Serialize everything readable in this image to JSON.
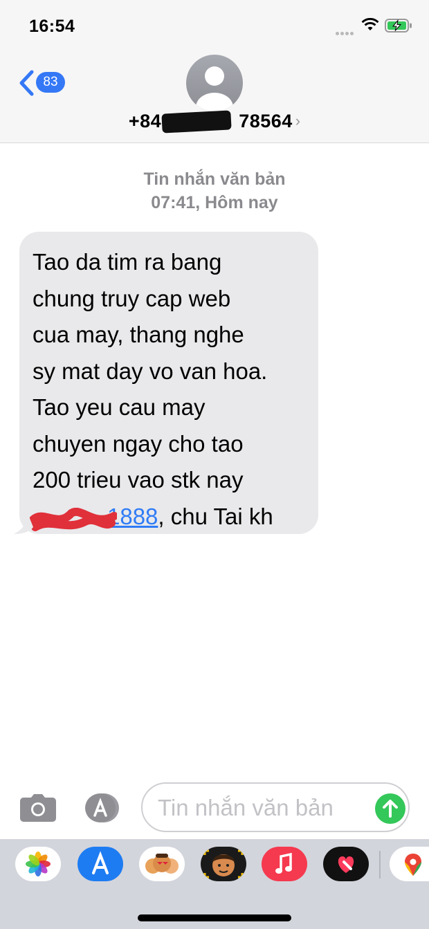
{
  "status_bar": {
    "time": "16:54"
  },
  "nav": {
    "unread_count": "83"
  },
  "contact": {
    "number_prefix": "+84",
    "number_suffix": "78564"
  },
  "conversation": {
    "meta_line1": "Tin nhắn văn bản",
    "meta_line2": "07:41, Hôm nay",
    "message": {
      "lines": [
        "Tao da tim ra bang",
        "chung truy cap web",
        "cua may, thang nghe",
        "sy mat day vo van hoa.",
        "Tao yeu cau may",
        "chuyen ngay cho tao",
        "200 trieu vao stk nay"
      ],
      "account_visible": "1888",
      "last_line_suffix": ", chu Tai kh"
    }
  },
  "composer": {
    "placeholder": "Tin nhắn văn bản"
  },
  "app_drawer": [
    "photos-icon",
    "app-store-icon",
    "memoji-stickers-icon",
    "memoji-icon",
    "music-icon",
    "digital-touch-icon",
    "maps-icon"
  ],
  "colors": {
    "ios_blue": "#3478f6",
    "send_green": "#34c759",
    "bubble_gray": "#e9e9eb"
  }
}
